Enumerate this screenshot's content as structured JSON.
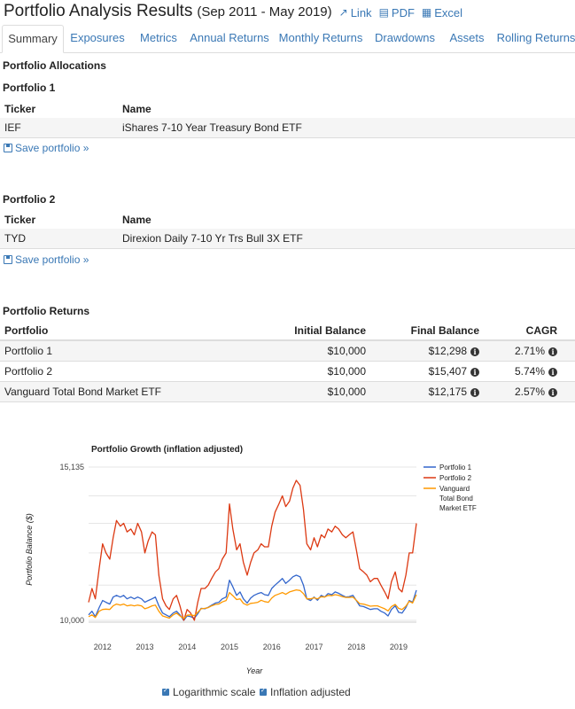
{
  "header": {
    "title": "Portfolio Analysis Results",
    "subtitle": "(Sep 2011 - May 2019)",
    "links": [
      {
        "label": "Link",
        "icon": "external-link-icon"
      },
      {
        "label": "PDF",
        "icon": "pdf-file-icon"
      },
      {
        "label": "Excel",
        "icon": "excel-file-icon"
      }
    ]
  },
  "tabs": [
    "Summary",
    "Exposures",
    "Metrics",
    "Annual Returns",
    "Monthly Returns",
    "Drawdowns",
    "Assets",
    "Rolling Returns"
  ],
  "active_tab": "Summary",
  "allocations": {
    "heading": "Portfolio Allocations",
    "col_ticker": "Ticker",
    "col_name": "Name",
    "save_label": "Save portfolio »",
    "portfolios": [
      {
        "title": "Portfolio 1",
        "ticker": "IEF",
        "name": "iShares 7-10 Year Treasury Bond ETF"
      },
      {
        "title": "Portfolio 2",
        "ticker": "TYD",
        "name": "Direxion Daily 7-10 Yr Trs Bull 3X ETF"
      }
    ]
  },
  "returns": {
    "heading": "Portfolio Returns",
    "columns": [
      "Portfolio",
      "Initial Balance",
      "Final Balance",
      "CAGR"
    ],
    "rows": [
      {
        "portfolio": "Portfolio 1",
        "initial": "$10,000",
        "final": "$12,298",
        "cagr": "2.71%"
      },
      {
        "portfolio": "Portfolio 2",
        "initial": "$10,000",
        "final": "$15,407",
        "cagr": "5.74%"
      },
      {
        "portfolio": "Vanguard Total Bond Market ETF",
        "initial": "$10,000",
        "final": "$12,175",
        "cagr": "2.57%"
      }
    ]
  },
  "chart_data": {
    "type": "line",
    "title": "Portfolio Growth (inflation adjusted)",
    "xlabel": "Year",
    "ylabel": "Portfolio Balance ($)",
    "y_scale": "log",
    "ylim": [
      10000,
      15135
    ],
    "y_ticks": [
      "10,000",
      "15,135"
    ],
    "x_ticks": [
      "2012",
      "2013",
      "2014",
      "2015",
      "2016",
      "2017",
      "2018",
      "2019"
    ],
    "legend_position": "right",
    "grid": true,
    "x": [
      2011.67,
      2011.75,
      2011.83,
      2011.92,
      2012.0,
      2012.08,
      2012.17,
      2012.25,
      2012.33,
      2012.42,
      2012.5,
      2012.58,
      2012.67,
      2012.75,
      2012.83,
      2012.92,
      2013.0,
      2013.08,
      2013.17,
      2013.25,
      2013.33,
      2013.42,
      2013.5,
      2013.58,
      2013.67,
      2013.75,
      2013.83,
      2013.92,
      2014.0,
      2014.08,
      2014.17,
      2014.25,
      2014.33,
      2014.42,
      2014.5,
      2014.58,
      2014.67,
      2014.75,
      2014.83,
      2014.92,
      2015.0,
      2015.08,
      2015.17,
      2015.25,
      2015.33,
      2015.42,
      2015.5,
      2015.58,
      2015.67,
      2015.75,
      2015.83,
      2015.92,
      2016.0,
      2016.08,
      2016.17,
      2016.25,
      2016.33,
      2016.42,
      2016.5,
      2016.58,
      2016.67,
      2016.75,
      2016.83,
      2016.92,
      2017.0,
      2017.08,
      2017.17,
      2017.25,
      2017.33,
      2017.42,
      2017.5,
      2017.58,
      2017.67,
      2017.75,
      2017.83,
      2017.92,
      2018.0,
      2018.08,
      2018.17,
      2018.25,
      2018.33,
      2018.42,
      2018.5,
      2018.58,
      2018.67,
      2018.75,
      2018.83,
      2018.92,
      2019.0,
      2019.08,
      2019.17,
      2019.25,
      2019.33,
      2019.42
    ],
    "series": [
      {
        "name": "Portfolio 1",
        "color": "#3366cc",
        "values": [
          10150,
          10250,
          10100,
          10350,
          10550,
          10500,
          10450,
          10650,
          10700,
          10650,
          10700,
          10600,
          10650,
          10600,
          10650,
          10600,
          10500,
          10550,
          10600,
          10650,
          10400,
          10200,
          10150,
          10100,
          10200,
          10250,
          10150,
          10000,
          10120,
          10100,
          10060,
          10180,
          10330,
          10320,
          10360,
          10420,
          10480,
          10500,
          10600,
          10650,
          11150,
          10950,
          10700,
          10800,
          10600,
          10480,
          10620,
          10700,
          10750,
          10780,
          10720,
          10700,
          10900,
          11000,
          11100,
          11200,
          11050,
          11150,
          11250,
          11300,
          11250,
          11000,
          10600,
          10550,
          10650,
          10560,
          10700,
          10650,
          10750,
          10720,
          10800,
          10760,
          10700,
          10650,
          10660,
          10700,
          10550,
          10400,
          10380,
          10340,
          10300,
          10320,
          10320,
          10250,
          10200,
          10120,
          10300,
          10400,
          10220,
          10200,
          10350,
          10550,
          10500,
          10850
        ]
      },
      {
        "name": "Portfolio 2",
        "color": "#dc3912",
        "values": [
          10500,
          10900,
          10600,
          11500,
          12300,
          12000,
          11800,
          12500,
          13100,
          12900,
          13000,
          12700,
          12800,
          12600,
          13000,
          12700,
          12000,
          12400,
          12700,
          12600,
          11300,
          10600,
          10400,
          10300,
          10600,
          10700,
          10400,
          10000,
          10300,
          10200,
          10000,
          10500,
          10900,
          10900,
          11000,
          11200,
          11400,
          11500,
          11800,
          12000,
          13700,
          12800,
          12100,
          12300,
          11700,
          11300,
          11700,
          12000,
          12100,
          12300,
          12200,
          12200,
          12900,
          13400,
          13700,
          14000,
          13600,
          13800,
          14300,
          14600,
          14400,
          13500,
          12300,
          12100,
          12500,
          12200,
          12600,
          12500,
          12800,
          12700,
          12900,
          12800,
          12600,
          12500,
          12600,
          12700,
          12100,
          11500,
          11400,
          11300,
          11100,
          11200,
          11200,
          11000,
          10800,
          10600,
          11100,
          11400,
          10900,
          10800,
          11300,
          12000,
          12000,
          13000
        ]
      },
      {
        "name": "Vanguard Total Bond Market ETF",
        "color": "#ff9900",
        "values": [
          10100,
          10150,
          10080,
          10250,
          10300,
          10310,
          10300,
          10400,
          10450,
          10420,
          10450,
          10400,
          10420,
          10400,
          10420,
          10400,
          10320,
          10350,
          10400,
          10420,
          10250,
          10120,
          10090,
          10060,
          10150,
          10200,
          10120,
          10050,
          10140,
          10150,
          10130,
          10220,
          10320,
          10330,
          10350,
          10400,
          10440,
          10450,
          10510,
          10550,
          10780,
          10690,
          10580,
          10600,
          10470,
          10420,
          10470,
          10480,
          10500,
          10560,
          10520,
          10500,
          10620,
          10700,
          10740,
          10780,
          10730,
          10800,
          10830,
          10860,
          10840,
          10750,
          10600,
          10600,
          10630,
          10600,
          10660,
          10650,
          10700,
          10690,
          10720,
          10700,
          10660,
          10640,
          10640,
          10650,
          10560,
          10460,
          10450,
          10420,
          10390,
          10400,
          10400,
          10360,
          10320,
          10260,
          10380,
          10440,
          10330,
          10300,
          10390,
          10530,
          10480,
          10720
        ]
      }
    ]
  },
  "options": [
    {
      "label": "Logarithmic scale",
      "checked": true
    },
    {
      "label": "Inflation adjusted",
      "checked": true
    }
  ]
}
